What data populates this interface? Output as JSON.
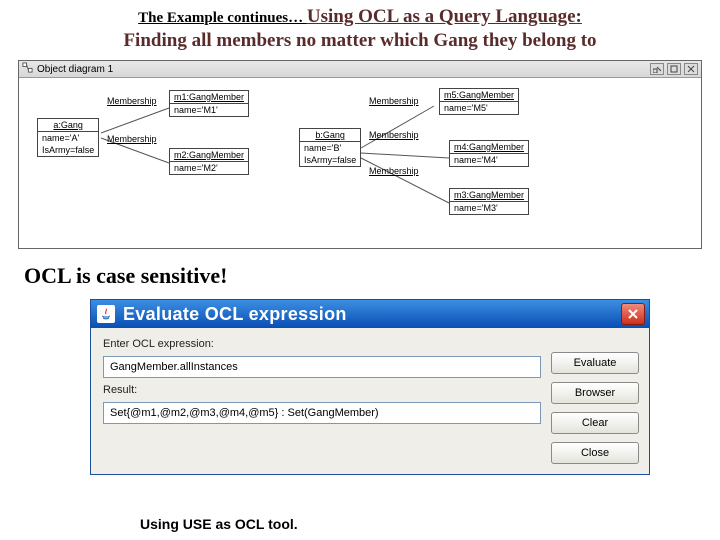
{
  "header": {
    "prefix": "The Example continues… ",
    "main": "Using OCL as a Query Language:",
    "line2": "Finding all members no matter which Gang they belong to"
  },
  "object_diagram": {
    "title": "Object diagram 1",
    "nodes": {
      "a_gang": {
        "title": "a:Gang",
        "attrs": [
          "name='A'",
          "IsArmy=false"
        ]
      },
      "m1": {
        "title": "m1:GangMember",
        "attrs": [
          "name='M1'"
        ]
      },
      "m2": {
        "title": "m2:GangMember",
        "attrs": [
          "name='M2'"
        ]
      },
      "b_gang": {
        "title": "b:Gang",
        "attrs": [
          "name='B'",
          "IsArmy=false"
        ]
      },
      "m5": {
        "title": "m5:GangMember",
        "attrs": [
          "name='M5'"
        ]
      },
      "m4": {
        "title": "m4:GangMember",
        "attrs": [
          "name='M4'"
        ]
      },
      "m3": {
        "title": "m3:GangMember",
        "attrs": [
          "name='M3'"
        ]
      }
    },
    "link_label": "Membership"
  },
  "warning_text": "OCL is case sensitive!",
  "dialog": {
    "title": "Evaluate OCL expression",
    "enter_label": "Enter OCL expression:",
    "enter_value": "GangMember.allInstances",
    "result_label": "Result:",
    "result_value": "Set{@m1,@m2,@m3,@m4,@m5} : Set(GangMember)",
    "buttons": {
      "evaluate": "Evaluate",
      "browser": "Browser",
      "clear": "Clear",
      "close": "Close"
    }
  },
  "footer": "Using USE as OCL tool."
}
